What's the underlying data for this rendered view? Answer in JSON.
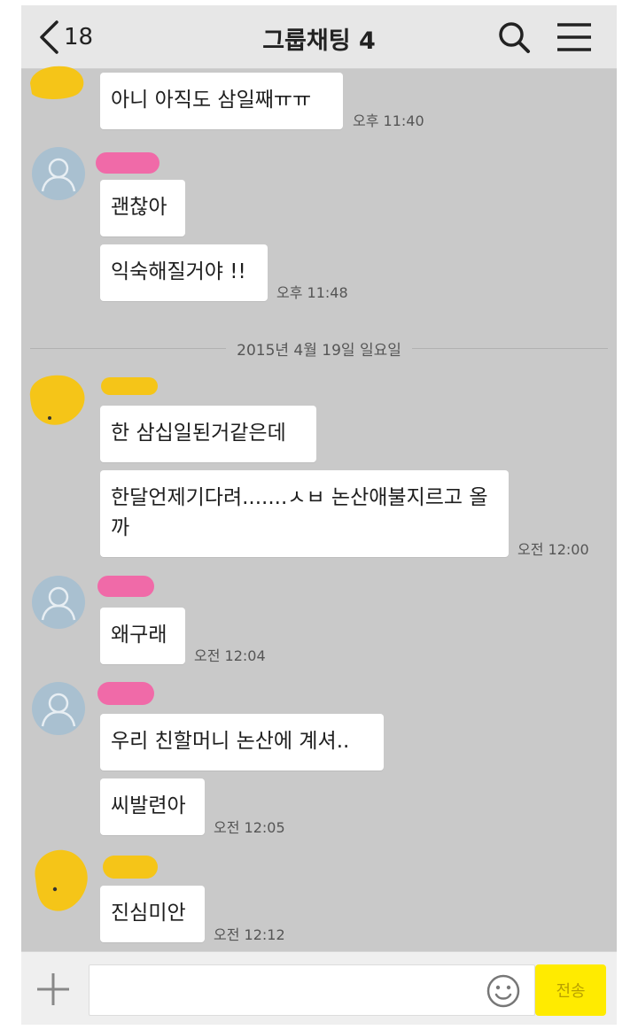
{
  "header": {
    "back_count": "18",
    "title": "그룹채팅 4"
  },
  "date_divider": "2015년 4월 19일 일요일",
  "messages": [
    {
      "text": "아니 아직도 삼일째ㅠㅠ",
      "time": "오후 11:40"
    },
    {
      "text": "괜찮아"
    },
    {
      "text": "익숙해질거야 !!",
      "time": "오후 11:48"
    },
    {
      "text": "한 삼십일된거같은데"
    },
    {
      "text": "한달언제기다려.......ㅅㅂ 논산애불지르고 올까",
      "time": "오전 12:00"
    },
    {
      "text": "왜구래",
      "time": "오전 12:04"
    },
    {
      "text": "우리 친할머니 논산에 계셔.."
    },
    {
      "text": "씨발련아",
      "time": "오전 12:05"
    },
    {
      "text": "진심미안",
      "time": "오전 12:12"
    }
  ],
  "input": {
    "value": "",
    "send_label": "전송"
  },
  "colors": {
    "chat_background": "#c9c9c9",
    "bubble": "#ffffff",
    "send_button": "#ffeb00",
    "redaction_yellow": "#f5c518",
    "redaction_pink": "#f06aa8"
  },
  "icons": [
    "back-arrow-icon",
    "search-icon",
    "menu-icon",
    "plus-icon",
    "emoji-icon",
    "default-profile-icon"
  ]
}
